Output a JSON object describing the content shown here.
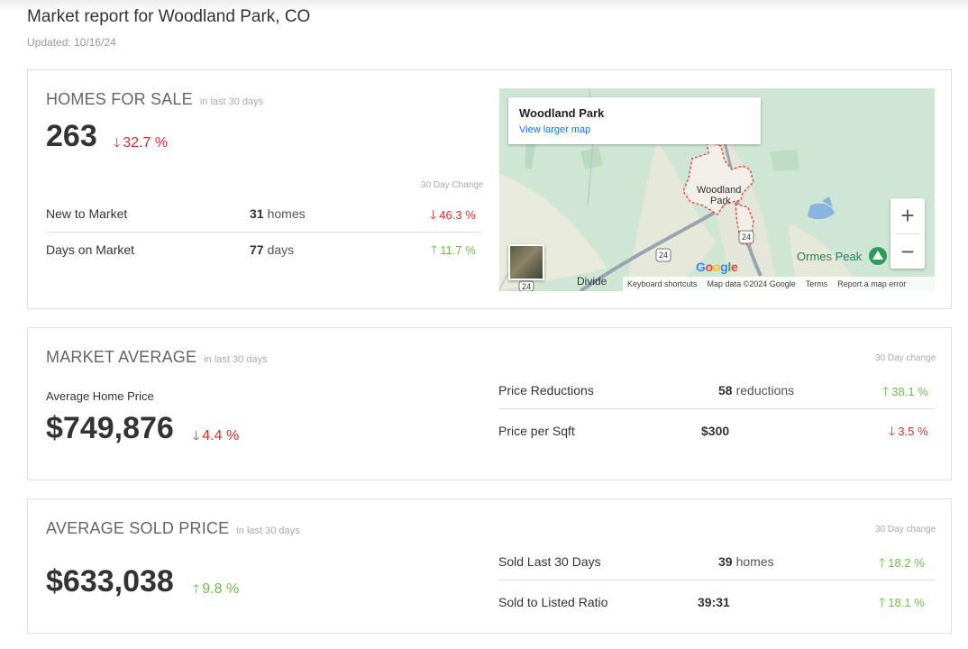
{
  "page": {
    "title": "Market report for Woodland Park, CO",
    "updated": "Updated: 10/16/24"
  },
  "homes_for_sale": {
    "title": "HOMES FOR SALE",
    "subtitle": "in last 30 days",
    "value": "263",
    "change": "32.7 %",
    "change_direction": "down",
    "change_header": "30 Day Change",
    "rows": [
      {
        "label": "New to Market",
        "value": "31",
        "unit": "homes",
        "change": "46.3 %",
        "direction": "down"
      },
      {
        "label": "Days on Market",
        "value": "77",
        "unit": "days",
        "change": "11.7 %",
        "direction": "up"
      }
    ]
  },
  "map": {
    "place_title": "Woodland Park",
    "larger_map_link": "View larger map",
    "town_label_1": "Woodland",
    "town_label_2": "Park",
    "peak_label": "Ormes Peak",
    "divide_label": "Divide",
    "route_24a": "24",
    "route_24b": "24",
    "route_24c": "24",
    "google_logo": "Google",
    "zoom_in": "+",
    "zoom_out": "−",
    "footer": {
      "shortcuts": "Keyboard shortcuts",
      "map_data": "Map data ©2024 Google",
      "terms": "Terms",
      "report": "Report a map error"
    }
  },
  "market_average": {
    "title": "MARKET AVERAGE",
    "subtitle": "in last 30 days",
    "change_header": "30 Day change",
    "price_label": "Average Home Price",
    "value": "$749,876",
    "change": "4.4 %",
    "change_direction": "down",
    "rows": [
      {
        "label": "Price Reductions",
        "value": "58",
        "unit": "reductions",
        "change": "38.1 %",
        "direction": "up"
      },
      {
        "label": "Price per Sqft",
        "value": "$300",
        "unit": "",
        "change": "3.5 %",
        "direction": "down"
      }
    ]
  },
  "average_sold": {
    "title": "AVERAGE SOLD PRICE",
    "subtitle": "in last 30 days",
    "change_header": "30 Day change",
    "value": "$633,038",
    "change": "9.8 %",
    "change_direction": "up",
    "rows": [
      {
        "label": "Sold Last 30 Days",
        "value": "39",
        "unit": "homes",
        "change": "18.2 %",
        "direction": "up"
      },
      {
        "label": "Sold to Listed Ratio",
        "value": "39:31",
        "unit": "",
        "change": "18.1 %",
        "direction": "up"
      }
    ]
  },
  "icons": {
    "arrow_down": "🡓",
    "arrow_up": "🡑"
  },
  "colors": {
    "down": "#d32f2f",
    "up": "#6cbf4a",
    "link": "#1a73e8"
  }
}
